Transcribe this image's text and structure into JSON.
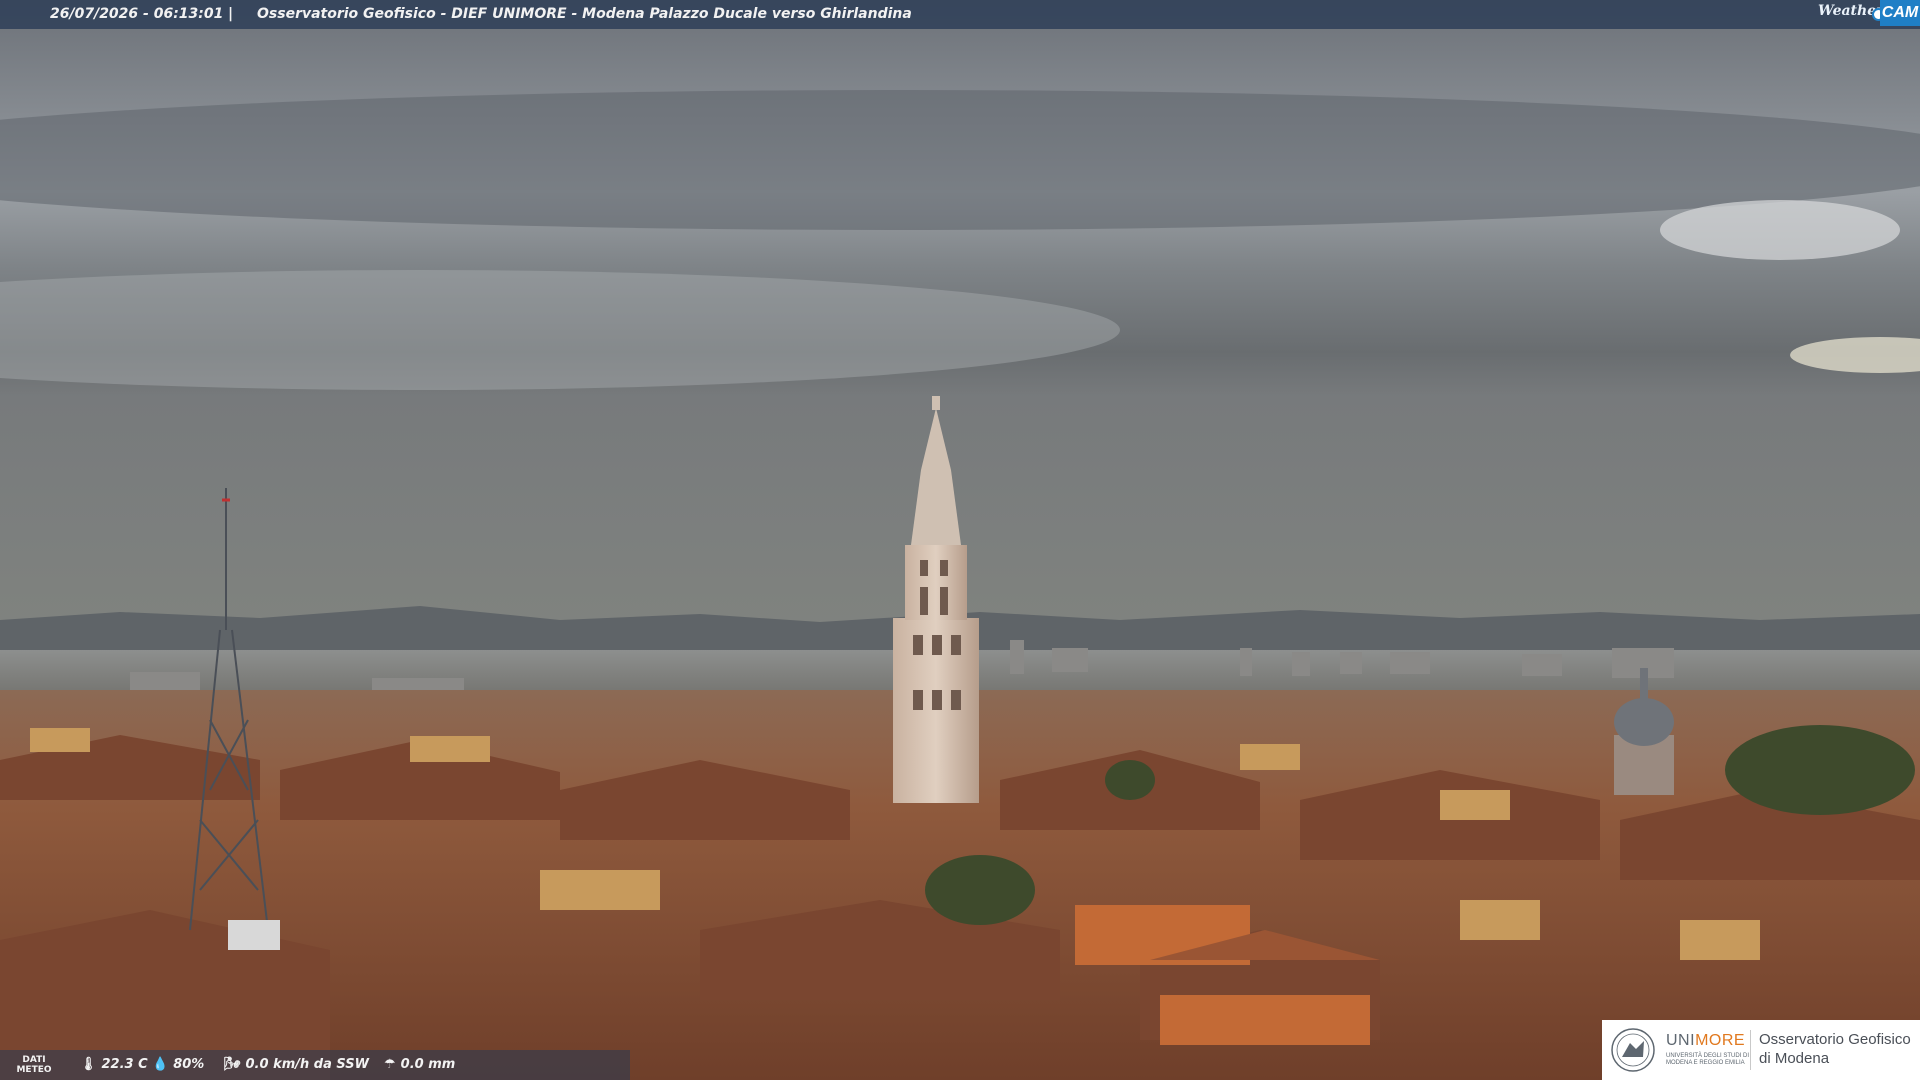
{
  "overlay": {
    "timestamp": "26/07/2026 - 06:13:01",
    "separator": "|",
    "title": "Osservatorio Geofisico - DIEF UNIMORE - Modena Palazzo Ducale verso Ghirlandina"
  },
  "brand": {
    "weather_text": "Weather",
    "cam_text": "CAM"
  },
  "meteo": {
    "label_line1": "DATI",
    "label_line2": "METEO",
    "temperature": "22.3 C",
    "humidity": "80%",
    "wind": "0.0 km/h da SSW",
    "rain": "0.0 mm",
    "icons": [
      "thermometer-icon",
      "humidity-drop-icon",
      "wind-icon",
      "rain-icon"
    ]
  },
  "institution": {
    "name_grey": "UNI",
    "name_orange": "MORE",
    "subtitle": "UNIVERSITÀ DEGLI STUDI DI MODENA E REGGIO EMILIA",
    "observatory_line1": "Osservatorio Geofisico",
    "observatory_line2": "di Modena"
  },
  "colors": {
    "overlay_bar": "#283a54",
    "brand_blue": "#1f7fc6",
    "unimore_orange": "#e1791f",
    "sky": "#7e8389",
    "roofs": "#9a5a3a"
  }
}
